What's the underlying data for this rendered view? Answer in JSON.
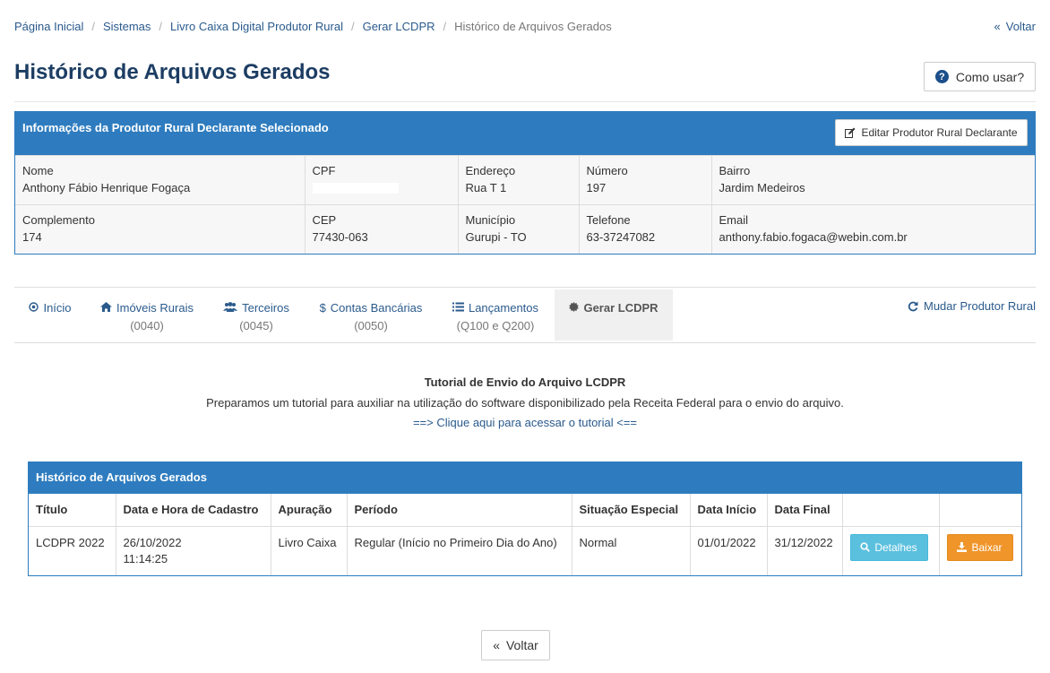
{
  "breadcrumb": {
    "items": [
      "Página Inicial",
      "Sistemas",
      "Livro Caixa Digital Produtor Rural",
      "Gerar LCDPR"
    ],
    "current": "Histórico de Arquivos Gerados"
  },
  "header": {
    "back_label": "Voltar",
    "title": "Histórico de Arquivos Gerados",
    "help_label": "Como usar?"
  },
  "info": {
    "title": "Informações da Produtor Rural Declarante Selecionado",
    "edit_label": "Editar Produtor Rural Declarante",
    "fields": {
      "nome": {
        "label": "Nome",
        "value": "Anthony Fábio Henrique Fogaça"
      },
      "cpf": {
        "label": "CPF",
        "value": ""
      },
      "endereco": {
        "label": "Endereço",
        "value": "Rua T 1"
      },
      "numero": {
        "label": "Número",
        "value": "197"
      },
      "bairro": {
        "label": "Bairro",
        "value": "Jardim Medeiros"
      },
      "complemento": {
        "label": "Complemento",
        "value": "174"
      },
      "cep": {
        "label": "CEP",
        "value": "77430-063"
      },
      "municipio": {
        "label": "Município",
        "value": "Gurupi - TO"
      },
      "telefone": {
        "label": "Telefone",
        "value": "63-37247082"
      },
      "email": {
        "label": "Email",
        "value": "anthony.fabio.fogaca@webin.com.br"
      }
    }
  },
  "tabs": {
    "inicio": {
      "label": "Início"
    },
    "imoveis": {
      "label": "Imóveis Rurais",
      "sub": "(0040)"
    },
    "terceiros": {
      "label": "Terceiros",
      "sub": "(0045)"
    },
    "contas": {
      "label": "Contas Bancárias",
      "sub": "(0050)"
    },
    "lancamentos": {
      "label": "Lançamentos",
      "sub": "(Q100 e Q200)"
    },
    "gerar": {
      "label": "Gerar LCDPR"
    },
    "mudar": {
      "label": "Mudar Produtor Rural"
    }
  },
  "tutorial": {
    "title": "Tutorial de Envio do Arquivo LCDPR",
    "text": "Preparamos um tutorial para auxiliar na utilização do software disponibilizado pela Receita Federal para o envio do arquivo.",
    "link": "==> Clique aqui para acessar o tutorial <=="
  },
  "history": {
    "title": "Histórico de Arquivos Gerados",
    "columns": [
      "Título",
      "Data e Hora de Cadastro",
      "Apuração",
      "Período",
      "Situação Especial",
      "Data Início",
      "Data Final"
    ],
    "rows": [
      {
        "titulo": "LCDPR 2022",
        "data_cadastro": "26/10/2022",
        "hora_cadastro": "11:14:25",
        "apuracao": "Livro Caixa",
        "periodo": "Regular (Início no Primeiro Dia do Ano)",
        "situacao": "Normal",
        "data_inicio": "01/01/2022",
        "data_final": "31/12/2022",
        "details_label": "Detalhes",
        "download_label": "Baixar"
      }
    ]
  },
  "footer": {
    "back_label": "Voltar"
  },
  "colors": {
    "panel_header": "#2e7cbf",
    "title": "#1c3d63",
    "link": "#2a5a8c",
    "details_button": "#5bc0de",
    "download_button": "#f0952a"
  }
}
